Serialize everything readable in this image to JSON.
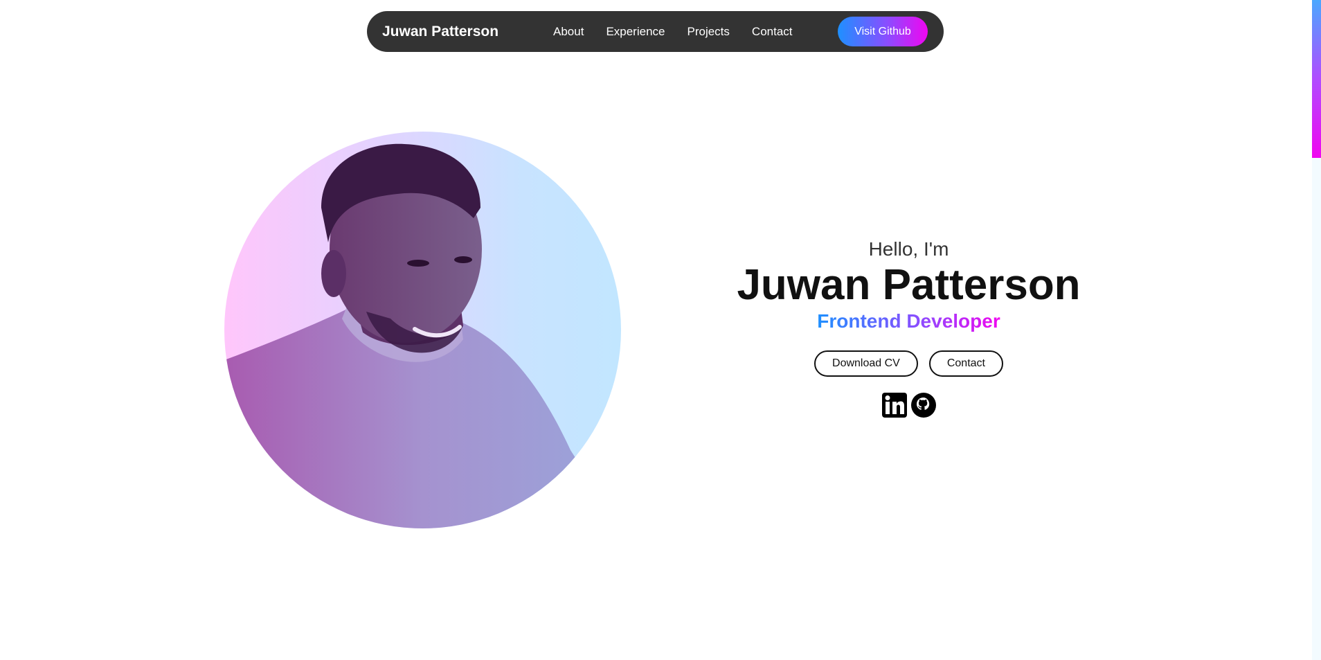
{
  "nav": {
    "logo": "Juwan Patterson",
    "links": [
      "About",
      "Experience",
      "Projects",
      "Contact"
    ],
    "cta_label": "Visit Github"
  },
  "hero": {
    "greeting": "Hello, I'm",
    "name": "Juwan Patterson",
    "role": "Frontend Developer",
    "buttons": {
      "download_cv": "Download CV",
      "contact": "Contact"
    },
    "socials": [
      "linkedin-icon",
      "github-icon"
    ],
    "photo": "profile-photo"
  },
  "colors": {
    "nav_bg": "#333333",
    "gradient_start": "#1e90ff",
    "gradient_mid": "#8a4dff",
    "gradient_end": "#f006f0",
    "text_dark": "#111111"
  }
}
